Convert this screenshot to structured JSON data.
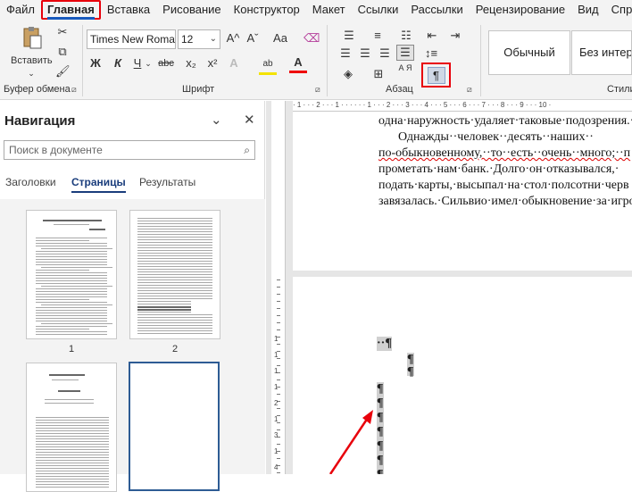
{
  "menu": {
    "tabs": [
      "Файл",
      "Главная",
      "Вставка",
      "Рисование",
      "Конструктор",
      "Макет",
      "Ссылки",
      "Рассылки",
      "Рецензирование",
      "Вид",
      "Справка"
    ]
  },
  "ribbon": {
    "clipboard": {
      "paste_label": "Вставить",
      "group_label": "Буфер обмена"
    },
    "font": {
      "font_name": "Times New Roman",
      "font_size": "12",
      "bold": "Ж",
      "italic": "К",
      "underline": "Ч",
      "strikethrough": "аbc",
      "subscript": "x₂",
      "superscript": "x²",
      "grow": "A^",
      "shrink": "Aˇ",
      "case": "Aa",
      "effects": "A",
      "highlight": "ab",
      "color": "A",
      "group_label": "Шрифт"
    },
    "paragraph": {
      "group_label": "Абзац",
      "show_marks": "¶",
      "sort_label": "А Я"
    },
    "styles": {
      "normal": "Обычный",
      "no_spacing": "Без интер",
      "group_label": "Стили"
    }
  },
  "nav": {
    "title": "Навигация",
    "search_placeholder": "Поиск в документе",
    "tabs": [
      "Заголовки",
      "Страницы",
      "Результаты"
    ],
    "page_numbers": [
      "1",
      "2"
    ]
  },
  "document": {
    "ruler_h": "· 1 · · · 2 · · · 1 · · · · · · 1 · · · 2 · · · 3 · · · 4 · · · 5 · · · 6 · · · 7 · · · 8 · · · 9 · · · 10 ·",
    "ruler_v": [
      "1",
      "1",
      "1",
      "1",
      "2",
      "1",
      "3",
      "1",
      "4"
    ],
    "lines": [
      "одна·наружность·удаляет·таковые·подозрения.·Ч",
      "Однажды··человек··десять··наших··",
      "по-обыкновенному,··то··есть··очень··много;··п",
      "прометать·нам·банк.·Долго·он·отказывался,·",
      "подать·карты,·высыпал·на·стол·полсотни·черв",
      "завязалась.·Сильвио·имел·обыкновение·за·игро"
    ],
    "pilcrow": "¶",
    "first_mark": "··¶"
  },
  "colors": {
    "accent": "#185abd",
    "highlight_red": "#e8000b"
  }
}
